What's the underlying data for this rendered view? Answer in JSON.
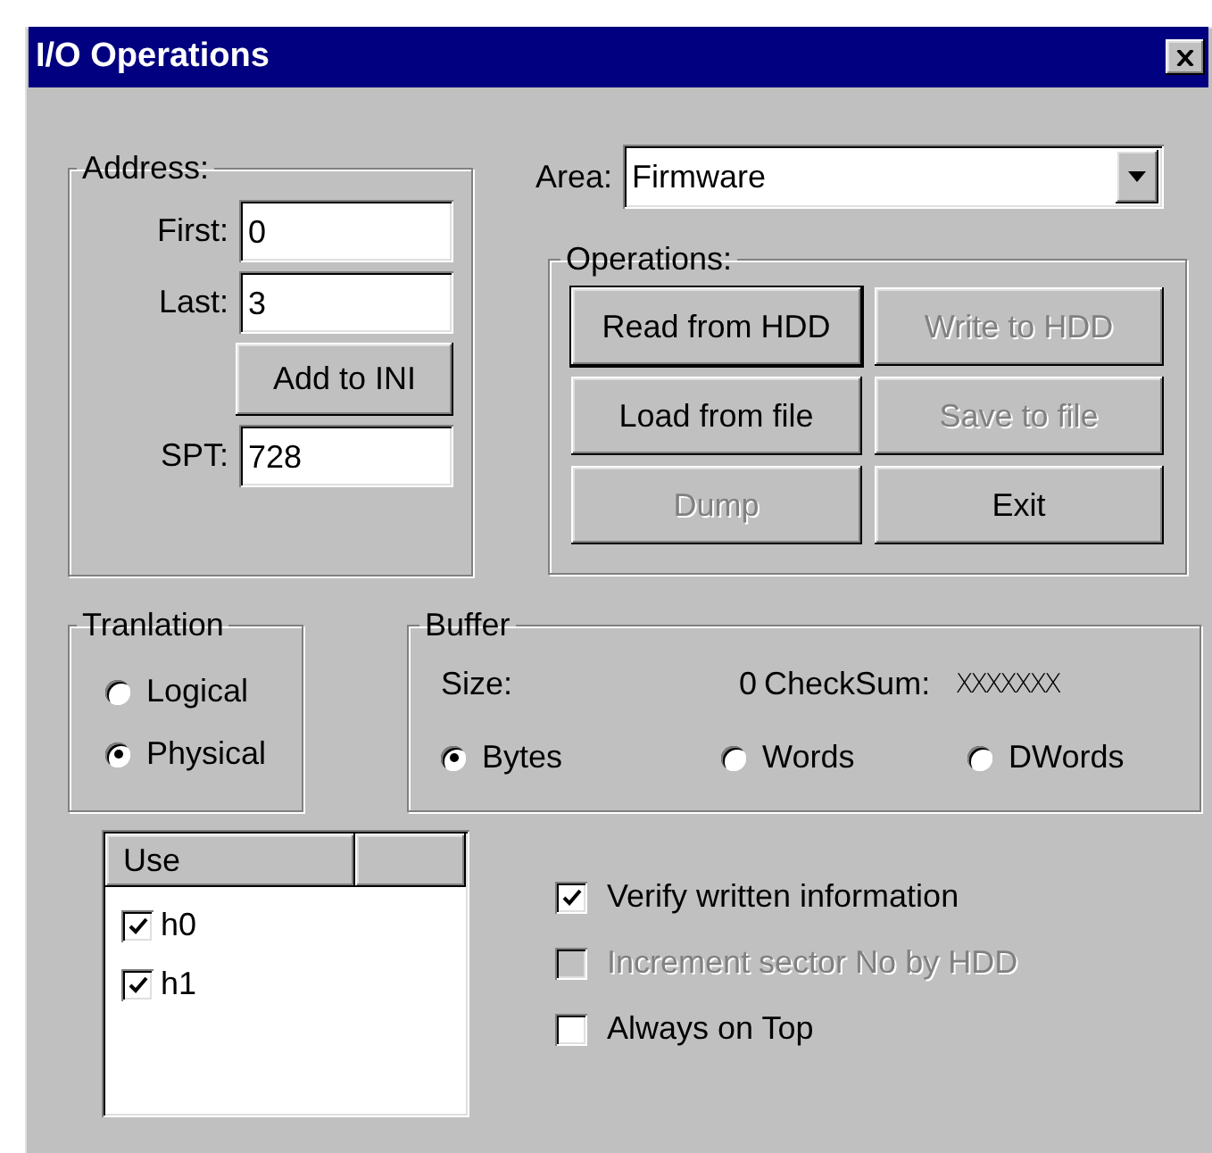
{
  "window": {
    "title": "I/O Operations"
  },
  "address": {
    "label": "Address:",
    "fields": [
      {
        "label": "First:",
        "value": "0"
      },
      {
        "label": "Last:",
        "value": "3"
      }
    ],
    "add_button": {
      "label": "Add to INI"
    },
    "spt": {
      "label": "SPT:",
      "value": "728"
    }
  },
  "area": {
    "label": "Area:",
    "value": "Firmware"
  },
  "operations": {
    "label": "Operations:",
    "buttons": [
      {
        "label": "Read from HDD",
        "disabled": false,
        "default": true
      },
      {
        "label": "Write to HDD",
        "disabled": true,
        "default": false
      },
      {
        "label": "Load from file",
        "disabled": false,
        "default": false
      },
      {
        "label": "Save to file",
        "disabled": true,
        "default": false
      },
      {
        "label": "Dump",
        "disabled": true,
        "default": false
      },
      {
        "label": "Exit",
        "disabled": false,
        "default": false
      }
    ]
  },
  "translation": {
    "label": "Tranlation",
    "options": [
      {
        "label": "Logical",
        "selected": false
      },
      {
        "label": "Physical",
        "selected": true
      }
    ]
  },
  "buffer": {
    "label": "Buffer",
    "size_label": "Size:",
    "size_value": "0",
    "checksum_label": "CheckSum:",
    "checksum_value": "XXXXXXX",
    "units": [
      {
        "label": "Bytes",
        "selected": true
      },
      {
        "label": "Words",
        "selected": false
      },
      {
        "label": "DWords",
        "selected": false
      }
    ]
  },
  "use_list": {
    "columns": [
      "Use"
    ],
    "items": [
      {
        "label": "h0",
        "checked": true
      },
      {
        "label": "h1",
        "checked": true
      }
    ]
  },
  "options": [
    {
      "label": "Verify written information",
      "checked": true,
      "disabled": false
    },
    {
      "label": "Increment sector No by HDD",
      "checked": false,
      "disabled": true
    },
    {
      "label": "Always on Top",
      "checked": false,
      "disabled": false
    }
  ]
}
